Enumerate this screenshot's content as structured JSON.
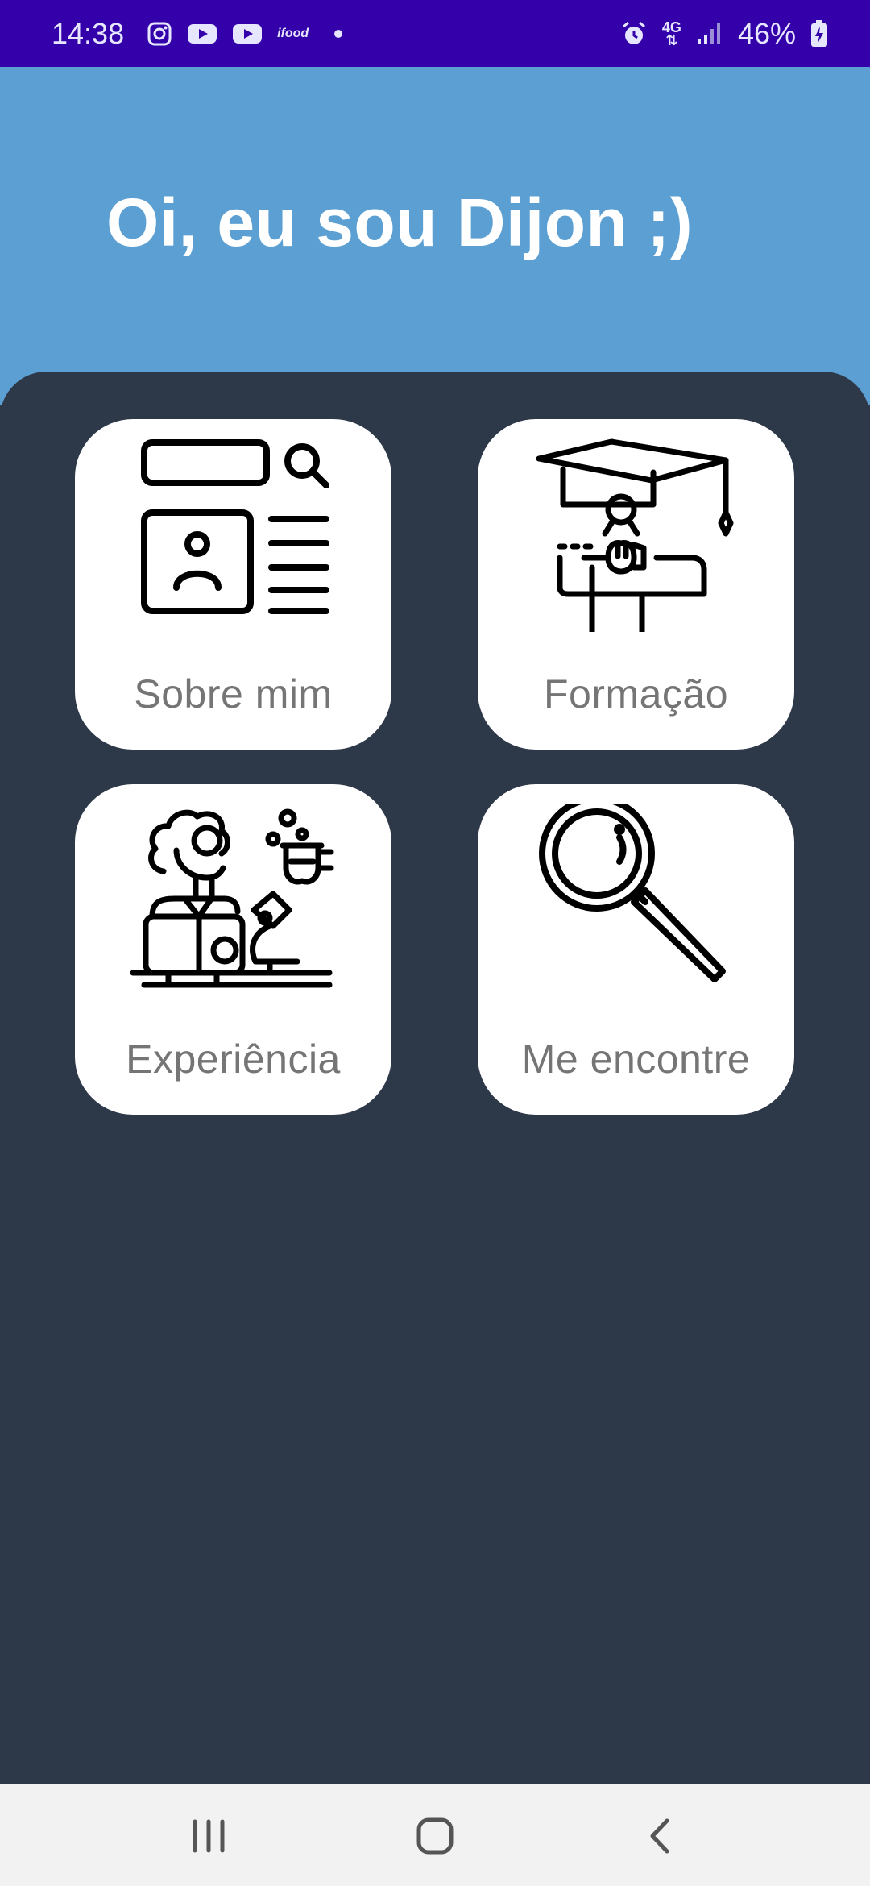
{
  "status_bar": {
    "time": "14:38",
    "notification_icons": [
      "instagram-icon",
      "youtube-icon",
      "youtube-icon",
      "ifood-icon",
      "dot-icon"
    ],
    "ifood_text": "ifood",
    "network_type": "4G",
    "battery_percent": "46%",
    "colors": {
      "background": "#3300aa",
      "text": "#e6e6ff"
    }
  },
  "header": {
    "greeting": "Oi, eu sou Dijon ;)",
    "background": "#5ca0d3"
  },
  "panel": {
    "background": "#2d3849"
  },
  "cards": [
    {
      "label": "Sobre mim",
      "icon": "profile-card-icon"
    },
    {
      "label": "Formação",
      "icon": "graduation-icon"
    },
    {
      "label": "Experiência",
      "icon": "scientist-icon"
    },
    {
      "label": "Me encontre",
      "icon": "magnifier-icon"
    }
  ],
  "nav_bar": {
    "buttons": [
      "recents-icon",
      "home-icon",
      "back-icon"
    ],
    "background": "#f2f2f2"
  }
}
